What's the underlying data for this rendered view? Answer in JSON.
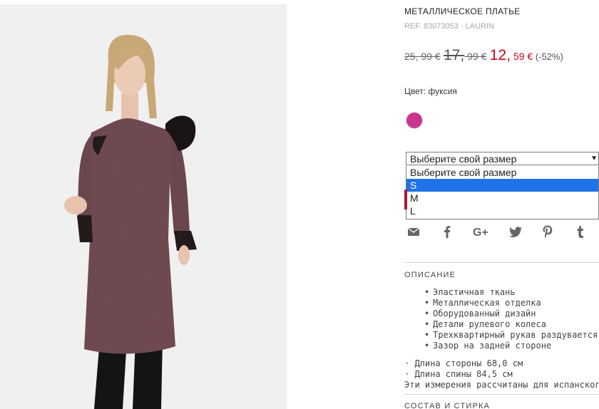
{
  "product": {
    "title": "МЕТАЛЛИЧЕСКОЕ ПЛАТЬЕ",
    "ref": "REF. 83073053 - LAURIN",
    "price": {
      "original": "25, 99 €",
      "previous_int": "17,",
      "previous_cents": " 99 €",
      "sale_int": "12,",
      "sale_cents": " 59  €",
      "discount": " (-52%)"
    },
    "color_label": "Цвет: фуксия",
    "color_swatch": "#c9358e"
  },
  "size_select": {
    "value": "Выберите свой размер",
    "options": [
      "Выберите свой размер",
      "S",
      "M",
      "L"
    ],
    "highlighted": "S"
  },
  "share_icons": [
    "mail-icon",
    "facebook-icon",
    "google-plus-icon",
    "twitter-icon",
    "pinterest-icon",
    "tumblr-icon"
  ],
  "description": {
    "heading": "ОПИСАНИЕ",
    "features": [
      "Эластичная ткань",
      "Металлическая отделка",
      "Оборудованный дизайн",
      "Детали рулевого колеса",
      "Трехквартирный рукав раздувается",
      "Зазор на задней стороне"
    ],
    "measurements": [
      "· Длина стороны 68,0 см",
      "· Длина спины 84,5 см",
      "Эти измерения рассчитаны для испанского р"
    ]
  },
  "composition": {
    "heading": "СОСТАВ И СТИРКА"
  },
  "colors": {
    "sale": "#d0021b",
    "highlight": "#1e73e8",
    "accent_mark": "#b0193a"
  }
}
